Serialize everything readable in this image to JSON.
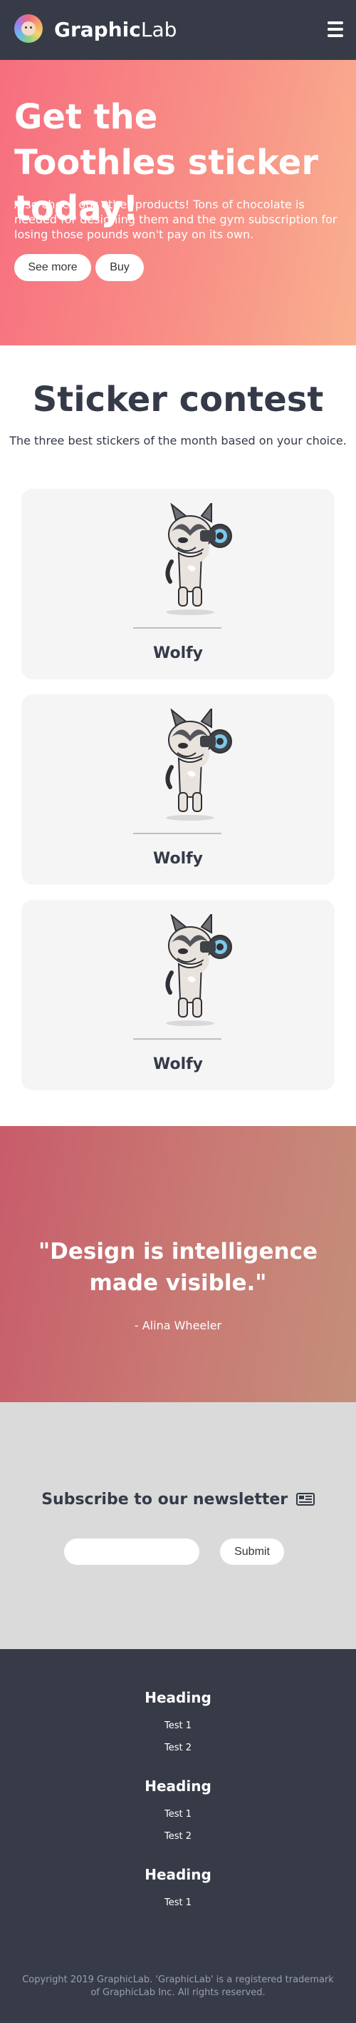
{
  "header": {
    "brand_bold": "Graphic",
    "brand_light": "Lab",
    "logo_icon": "logo-avatar-icon",
    "menu_icon": "hamburger-menu-icon"
  },
  "hero": {
    "title": "Get the Toothles sticker today!",
    "text": "Also check our other products! Tons of chocolate is needed for designing them and the gym subscription for losing those pounds won't pay on its own.",
    "see_more_label": "See more",
    "buy_label": "Buy",
    "gradient_start": "#f76e7f",
    "gradient_end": "#f9b08f"
  },
  "contest": {
    "title": "Sticker contest",
    "subtitle": "The three best stickers of the month based on your choice.",
    "cards": [
      {
        "name": "Wolfy",
        "image": "husky-with-binoculars-sticker"
      },
      {
        "name": "Wolfy",
        "image": "husky-with-binoculars-sticker"
      },
      {
        "name": "Wolfy",
        "image": "husky-with-binoculars-sticker"
      }
    ]
  },
  "quote": {
    "text": "\"Design is intelligence made visible.\"",
    "author": "- Alina Wheeler"
  },
  "newsletter": {
    "title": "Subscribe to our newsletter",
    "title_icon": "newspaper-icon",
    "input_value": "",
    "submit_label": "Submit"
  },
  "footer": {
    "sections": [
      {
        "heading": "Heading",
        "links": [
          "Test 1",
          "Test 2"
        ]
      },
      {
        "heading": "Heading",
        "links": [
          "Test 1",
          "Test 2"
        ]
      },
      {
        "heading": "Heading",
        "links": [
          "Test 1"
        ]
      }
    ],
    "copyright": "Copyright 2019 GraphicLab. 'GraphicLab' is a registered trademark of GraphicLab Inc. All rights reserved."
  },
  "colors": {
    "dark": "#363b47",
    "text": "#343a48",
    "card_bg": "#f5f5f5",
    "newsletter_bg": "#dadada"
  }
}
